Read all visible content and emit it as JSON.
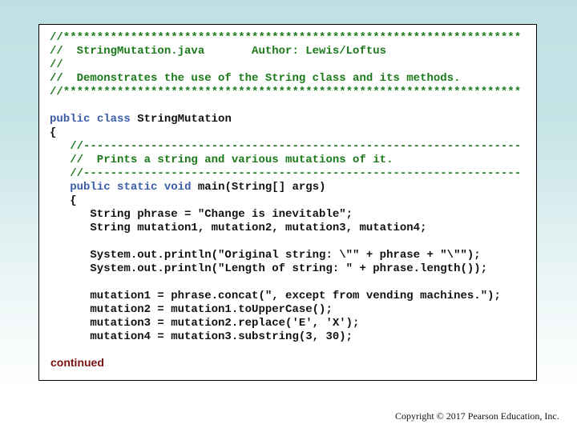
{
  "slide": {
    "continued_label": "continued",
    "copyright": "Copyright © 2017 Pearson Education, Inc.",
    "colors": {
      "comment": "#1a7a1a",
      "keyword": "#3a5ca8",
      "code": "#111111",
      "continued": "#7a1010"
    }
  },
  "code": {
    "header": {
      "border": "//********************************************************************",
      "file_line": "//  StringMutation.java       Author: Lewis/Loftus",
      "empty_comment": "//",
      "description": "//  Demonstrates the use of the String class and its methods."
    },
    "class_decl": {
      "kw_public": "public",
      "kw_class": "class",
      "name": " StringMutation"
    },
    "open_brace": "{",
    "method_comment": {
      "divider": "   //-----------------------------------------------------------------",
      "text": "   //  Prints a string and various mutations of it."
    },
    "method_decl": {
      "indent": "   ",
      "kw_public": "public",
      "kw_static": "static",
      "kw_void": "void",
      "signature": " main(String[] args)"
    },
    "method_open_brace": "   {",
    "body": [
      "      String phrase = \"Change is inevitable\";",
      "      String mutation1, mutation2, mutation3, mutation4;",
      "",
      "      System.out.println(\"Original string: \\\"\" + phrase + \"\\\"\");",
      "      System.out.println(\"Length of string: \" + phrase.length());",
      "",
      "      mutation1 = phrase.concat(\", except from vending machines.\");",
      "      mutation2 = mutation1.toUpperCase();",
      "      mutation3 = mutation2.replace('E', 'X');",
      "      mutation4 = mutation3.substring(3, 30);"
    ]
  }
}
